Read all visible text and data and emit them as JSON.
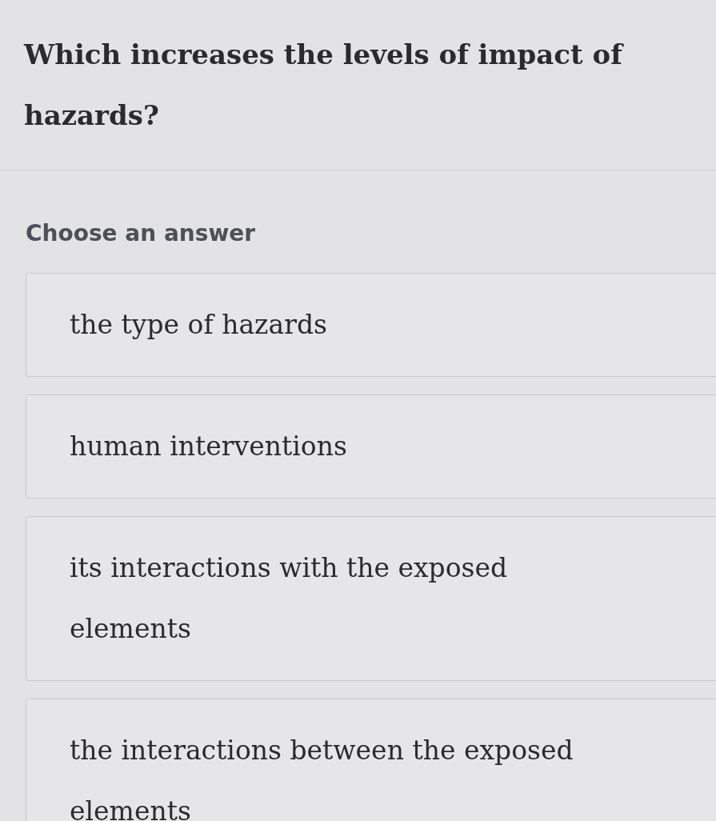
{
  "question": "Which increases the levels of impact of hazards?",
  "prompt": "Choose an answer",
  "options": [
    {
      "text": "the type of hazards"
    },
    {
      "text": "human interventions"
    },
    {
      "text": "its interactions with the exposed elements"
    },
    {
      "text": "the interactions between the exposed elements"
    }
  ]
}
